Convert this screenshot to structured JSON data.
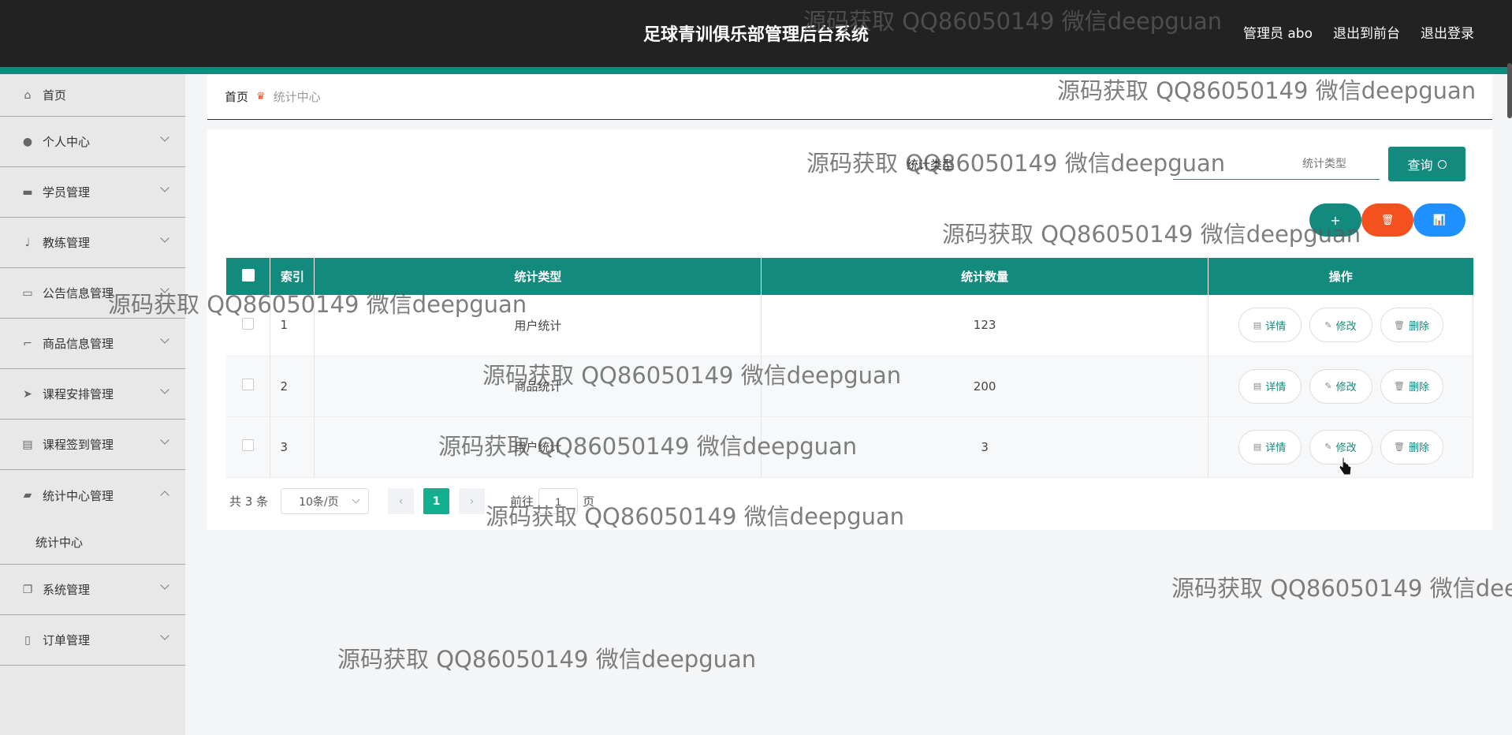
{
  "header": {
    "title": "足球青训俱乐部管理后台系统",
    "links": [
      "管理员 abo",
      "退出到前台",
      "退出登录"
    ]
  },
  "sidebar": {
    "items": [
      {
        "label": "首页",
        "icon": "home-icon"
      },
      {
        "label": "个人中心",
        "icon": "user-icon"
      },
      {
        "label": "学员管理",
        "icon": "briefcase-icon"
      },
      {
        "label": "教练管理",
        "icon": "microphone-icon"
      },
      {
        "label": "公告信息管理",
        "icon": "chat-icon"
      },
      {
        "label": "商品信息管理",
        "icon": "crop-icon"
      },
      {
        "label": "课程安排管理",
        "icon": "send-icon"
      },
      {
        "label": "课程签到管理",
        "icon": "clipboard-icon"
      },
      {
        "label": "统计中心管理",
        "icon": "ticket-icon"
      },
      {
        "label": "系统管理",
        "icon": "copy-icon"
      },
      {
        "label": "订单管理",
        "icon": "phone-icon"
      }
    ],
    "sub_item": "统计中心"
  },
  "breadcrumb": {
    "home": "首页",
    "current": "统计中心"
  },
  "search": {
    "label": "统计类型",
    "placeholder": "统计类型",
    "button": "查询"
  },
  "actions": {
    "add": "+",
    "delete": "🗑",
    "chart": "📊"
  },
  "table": {
    "headers": [
      "索引",
      "统计类型",
      "统计数量",
      "操作"
    ],
    "rows": [
      {
        "index": "1",
        "type": "用户统计",
        "count": "123"
      },
      {
        "index": "2",
        "type": "商品统计",
        "count": "200"
      },
      {
        "index": "3",
        "type": "用户统计",
        "count": "3"
      }
    ],
    "op_labels": {
      "detail": "详情",
      "edit": "修改",
      "delete": "删除"
    }
  },
  "pagination": {
    "total": "共 3 条",
    "page_size": "10条/页",
    "current_page": "1",
    "goto_label": "前往",
    "goto_value": "1",
    "page_unit": "页"
  },
  "watermark": "源码获取 QQ86050149 微信deepguan",
  "colors": {
    "primary": "#138a7e",
    "danger": "#f4511e",
    "info": "#1e90ff",
    "header_bg": "#222222"
  }
}
